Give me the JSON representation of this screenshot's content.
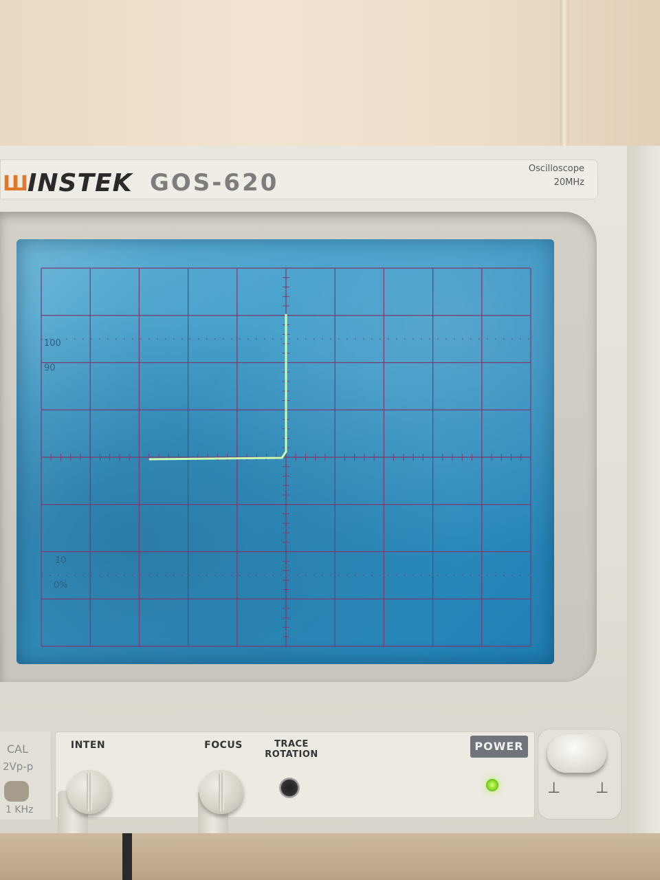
{
  "device": {
    "brand": "INSTEK",
    "logo_mark": "Ш",
    "model": "GOS-620",
    "type": "Oscilloscope",
    "bandwidth": "20MHz"
  },
  "screen": {
    "graticule_labels": {
      "top_100": "100",
      "top_90": "90",
      "bottom_10": "10",
      "bottom_0": "0%"
    },
    "trace_color": "#c8ffb0",
    "screen_color": "#2f8dbf",
    "grid_color": "#7a3a6a"
  },
  "panel": {
    "cal_label": "CAL",
    "cal_value": "2Vp-p",
    "cal_freq": "1 KHz",
    "inten_label": "INTEN",
    "focus_label": "FOCUS",
    "trace_rotation_line1": "TRACE",
    "trace_rotation_line2": "ROTATION",
    "power_label": "POWER",
    "power_symbols": "⊥ ⊥"
  }
}
